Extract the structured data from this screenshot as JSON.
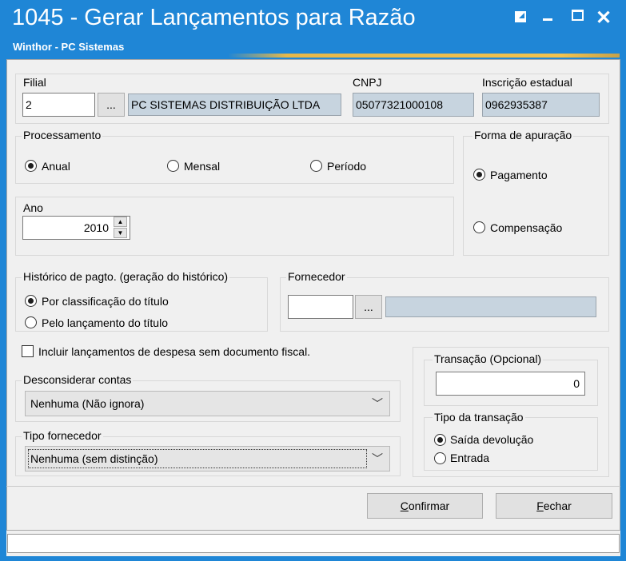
{
  "window": {
    "title": "1045 - Gerar Lançamentos para Razão",
    "subtitle": "Winthor - PC Sistemas"
  },
  "filial": {
    "label": "Filial",
    "code": "2",
    "lookup_label": "...",
    "name": "PC SISTEMAS DISTRIBUIÇÃO LTDA"
  },
  "cnpj": {
    "label": "CNPJ",
    "value": "05077321000108"
  },
  "inscricao": {
    "label": "Inscrição estadual",
    "value": "0962935387"
  },
  "processamento": {
    "legend": "Processamento",
    "options": [
      "Anual",
      "Mensal",
      "Período"
    ],
    "selected": "Anual"
  },
  "forma_apuracao": {
    "legend": "Forma de apuração",
    "options": [
      "Pagamento",
      "Compensação"
    ],
    "selected": "Pagamento"
  },
  "ano": {
    "label": "Ano",
    "value": "2010"
  },
  "historico": {
    "legend": "Histórico de pagto. (geração do histórico)",
    "options": [
      "Por classificação do título",
      "Pelo lançamento do título"
    ],
    "selected": "Por classificação do título"
  },
  "fornecedor": {
    "legend": "Fornecedor",
    "code": "",
    "lookup_label": "...",
    "name": ""
  },
  "incluir": {
    "label": "Incluir lançamentos de despesa sem documento fiscal.",
    "checked": false
  },
  "desconsiderar": {
    "legend": "Desconsiderar contas",
    "selected": "Nenhuma (Não ignora)"
  },
  "tipo_fornecedor": {
    "legend": "Tipo fornecedor",
    "selected": "Nenhuma (sem distinção)"
  },
  "transacao": {
    "legend": "Transação (Opcional)",
    "value": "0"
  },
  "tipo_transacao": {
    "legend": "Tipo da transação",
    "options": [
      "Saída devolução",
      "Entrada"
    ],
    "selected": "Saída devolução"
  },
  "buttons": {
    "confirmar_hotkey": "C",
    "confirmar_rest": "onfirmar",
    "fechar_hotkey": "F",
    "fechar_rest": "echar"
  },
  "icons": {
    "restore": "restore-icon",
    "minimize": "minimize-icon",
    "maximize": "maximize-icon",
    "close": "close-icon",
    "chevron": "chevron-down-icon",
    "spin_up": "spin-up-icon",
    "spin_down": "spin-down-icon"
  },
  "colors": {
    "titlebar": "#1f86d6",
    "readonly_field": "#c7d4df",
    "client": "#f0f0f0"
  }
}
